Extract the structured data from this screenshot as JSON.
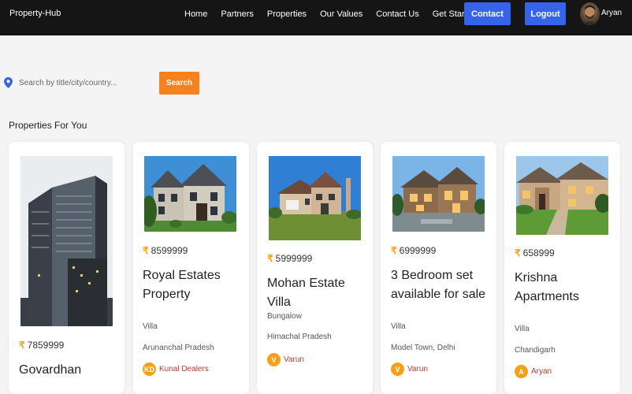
{
  "nav": {
    "brand": "Property-Hub",
    "links": [
      "Home",
      "Partners",
      "Properties",
      "Our Values",
      "Contact Us",
      "Get Started"
    ],
    "contact_button": "Contact",
    "logout_button": "Logout",
    "user_name": "Aryan"
  },
  "search": {
    "placeholder": "Search by title/city/country...",
    "button_label": "Search"
  },
  "section_title": "Properties For You",
  "properties": [
    {
      "price": "7859999",
      "title": "Govardhan",
      "type": "",
      "location": "",
      "dealer": "",
      "dealer_initials": ""
    },
    {
      "price": "8599999",
      "title": "Royal Estates Property",
      "type": "Villa",
      "location": "Arunanchal Pradesh",
      "dealer": "Kunal Dealers",
      "dealer_initials": "KD"
    },
    {
      "price": "5999999",
      "title": "Mohan Estate Villa",
      "type": "Bungalow",
      "location": "Himachal Pradesh",
      "dealer": "Varun",
      "dealer_initials": "V"
    },
    {
      "price": "6999999",
      "title": "3 Bedroom set available for sale",
      "type": "Villa",
      "location": "Model Town, Delhi",
      "dealer": "Varun",
      "dealer_initials": "V"
    },
    {
      "price": "658999",
      "title": "Krishna Apartments",
      "type": "Villa",
      "location": "Chandigarh",
      "dealer": "Aryan",
      "dealer_initials": "A"
    }
  ],
  "currency_symbol": "₹",
  "colors": {
    "navbar": "#151515",
    "accent_blue": "#3563e9",
    "accent_orange": "#f6821f",
    "badge": "#f6a019"
  }
}
